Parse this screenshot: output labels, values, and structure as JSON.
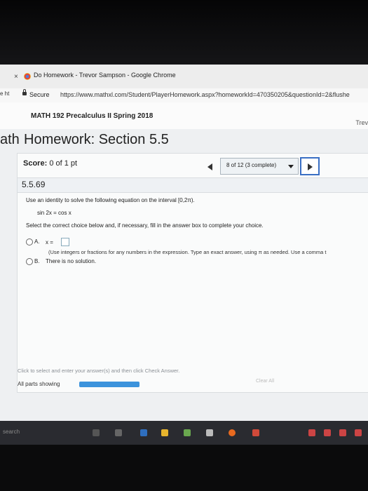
{
  "window": {
    "title": "Do Homework - Trevor Sampson - Google Chrome",
    "close_glyph": "×"
  },
  "addressbar": {
    "tab_stub": "e  ht",
    "secure_label": "Secure",
    "url": "https://www.mathxl.com/Student/PlayerHomework.aspx?homeworkId=470350205&questionId=2&flushe"
  },
  "course": {
    "title": "MATH 192 Precalculus II Spring 2018",
    "user_stub": "Trev"
  },
  "homework": {
    "prefix_stub": "ath",
    "title": "Homework: Section 5.5"
  },
  "score": {
    "label": "Score:",
    "value": "0 of 1 pt"
  },
  "navigation": {
    "position_text": "8 of 12 (3 complete)"
  },
  "question": {
    "id": "5.5.69",
    "prompt": "Use an identity to solve the following equation on the interval [0,2π).",
    "equation": "sin 2x = cos x",
    "instruction": "Select the correct choice below and, if necessary, fill in the answer box to complete your choice.",
    "choices": [
      {
        "letter": "A.",
        "text": "x ="
      },
      {
        "letter": "B.",
        "text": "There is no solution."
      }
    ],
    "choice_a_hint": "(Use integers or fractions for any numbers in the expression. Type an exact answer, using π as needed. Use a comma t"
  },
  "footer": {
    "hint": "Click to select and enter your answer(s) and then click Check Answer.",
    "parts_label": "All parts showing",
    "progress_fraction": 1.0,
    "clear_label": "Clear All"
  },
  "taskbar": {
    "search_label": "search"
  },
  "colors": {
    "accent": "#3c93dc",
    "nav_highlight": "#3a6fc4"
  }
}
